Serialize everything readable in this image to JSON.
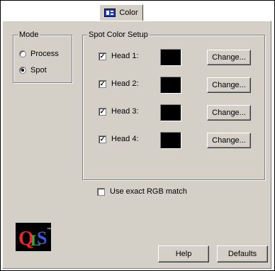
{
  "tab": {
    "label": "Color",
    "icon": "color-tab-icon"
  },
  "mode": {
    "title": "Mode",
    "options": [
      {
        "label": "Process",
        "selected": false
      },
      {
        "label": "Spot",
        "selected": true
      }
    ]
  },
  "spot": {
    "title": "Spot Color Setup",
    "heads": [
      {
        "label": "Head 1:",
        "checked": true,
        "color": "#000000",
        "button": "Change..."
      },
      {
        "label": "Head 2:",
        "checked": true,
        "color": "#000000",
        "button": "Change..."
      },
      {
        "label": "Head 3:",
        "checked": true,
        "color": "#000000",
        "button": "Change..."
      },
      {
        "label": "Head 4:",
        "checked": true,
        "color": "#000000",
        "button": "Change..."
      }
    ]
  },
  "rgb_match": {
    "label": "Use exact RGB match",
    "checked": false
  },
  "footer": {
    "help": "Help",
    "defaults": "Defaults"
  },
  "logo": {
    "text": "QLS",
    "tm": "™"
  }
}
